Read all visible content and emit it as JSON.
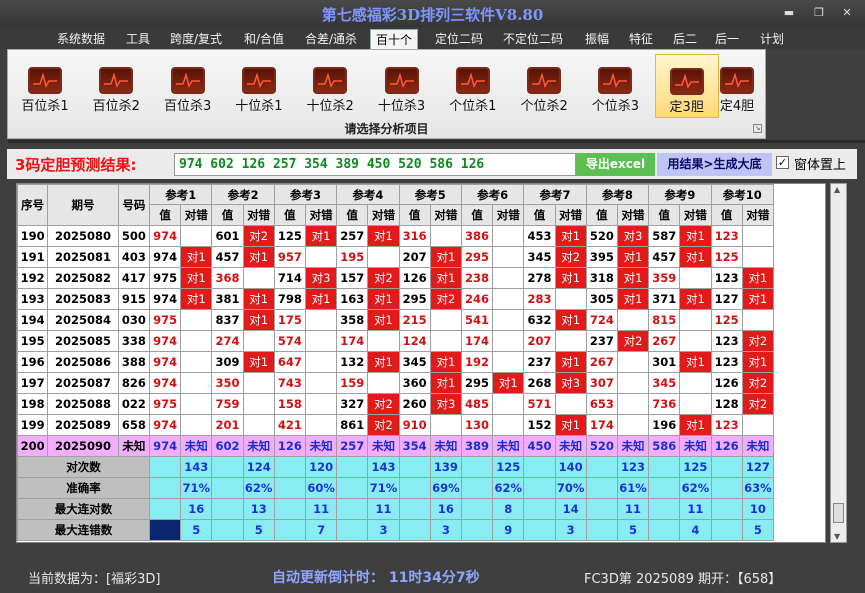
{
  "app": {
    "title": "第七感福彩3D排列三软件V8.80"
  },
  "window_controls": {
    "minimize": "▬",
    "restore": "❐",
    "close": "✕"
  },
  "menu": [
    "系统数据",
    "工具",
    "跨度/复式",
    "和/合值",
    "合差/通杀",
    "百十个",
    "定位二码",
    "不定位二码",
    "振幅",
    "特征",
    "后二",
    "后一",
    "计划"
  ],
  "menu_active": "百十个",
  "ribbon": {
    "buttons": [
      "百位杀1",
      "百位杀2",
      "百位杀3",
      "十位杀1",
      "十位杀2",
      "十位杀3",
      "个位杀1",
      "个位杀2",
      "个位杀3",
      "定3胆",
      "定4胆"
    ],
    "active": "定3胆",
    "caption": "请选择分析项目"
  },
  "prediction": {
    "label": "3码定胆预测结果:",
    "value": "974 602 126 257 354 389 450 520 586 126",
    "export_button": "导出excel",
    "big_button": "用结果>生成大底",
    "checkbox_checked": true,
    "checkbox_mark": "✓",
    "checkbox_label": "窗体置上"
  },
  "table": {
    "col_headers": {
      "seq": "序号",
      "period": "期号",
      "number": "号码"
    },
    "ref_headers": [
      "参考1",
      "参考2",
      "参考3",
      "参考4",
      "参考5",
      "参考6",
      "参考7",
      "参考8",
      "参考9",
      "参考10"
    ],
    "sub_headers": {
      "value": "值",
      "result": "对错"
    },
    "rows": [
      {
        "seq": "190",
        "period": "2025080",
        "number": "500",
        "refs": [
          [
            "974",
            ""
          ],
          [
            "601",
            "对2"
          ],
          [
            "125",
            "对1"
          ],
          [
            "257",
            "对1"
          ],
          [
            "316",
            ""
          ],
          [
            "386",
            ""
          ],
          [
            "453",
            "对1"
          ],
          [
            "520",
            "对3"
          ],
          [
            "587",
            "对1"
          ],
          [
            "123",
            ""
          ]
        ]
      },
      {
        "seq": "191",
        "period": "2025081",
        "number": "403",
        "refs": [
          [
            "974",
            "对1"
          ],
          [
            "457",
            "对1"
          ],
          [
            "957",
            ""
          ],
          [
            "195",
            ""
          ],
          [
            "207",
            "对1"
          ],
          [
            "295",
            ""
          ],
          [
            "345",
            "对2"
          ],
          [
            "395",
            "对1"
          ],
          [
            "457",
            "对1"
          ],
          [
            "125",
            ""
          ]
        ]
      },
      {
        "seq": "192",
        "period": "2025082",
        "number": "417",
        "refs": [
          [
            "975",
            "对1"
          ],
          [
            "368",
            ""
          ],
          [
            "714",
            "对3"
          ],
          [
            "157",
            "对2"
          ],
          [
            "126",
            "对1"
          ],
          [
            "238",
            ""
          ],
          [
            "278",
            "对1"
          ],
          [
            "318",
            "对1"
          ],
          [
            "359",
            ""
          ],
          [
            "123",
            "对1"
          ]
        ]
      },
      {
        "seq": "193",
        "period": "2025083",
        "number": "915",
        "refs": [
          [
            "974",
            "对1"
          ],
          [
            "381",
            "对1"
          ],
          [
            "798",
            "对1"
          ],
          [
            "163",
            "对1"
          ],
          [
            "295",
            "对2"
          ],
          [
            "246",
            ""
          ],
          [
            "283",
            ""
          ],
          [
            "305",
            "对1"
          ],
          [
            "371",
            "对1"
          ],
          [
            "127",
            "对1"
          ]
        ]
      },
      {
        "seq": "194",
        "period": "2025084",
        "number": "030",
        "refs": [
          [
            "975",
            ""
          ],
          [
            "837",
            "对1"
          ],
          [
            "175",
            ""
          ],
          [
            "358",
            "对1"
          ],
          [
            "215",
            ""
          ],
          [
            "541",
            ""
          ],
          [
            "632",
            "对1"
          ],
          [
            "724",
            ""
          ],
          [
            "815",
            ""
          ],
          [
            "125",
            ""
          ]
        ]
      },
      {
        "seq": "195",
        "period": "2025085",
        "number": "338",
        "refs": [
          [
            "974",
            ""
          ],
          [
            "274",
            ""
          ],
          [
            "574",
            ""
          ],
          [
            "174",
            ""
          ],
          [
            "124",
            ""
          ],
          [
            "174",
            ""
          ],
          [
            "207",
            ""
          ],
          [
            "237",
            "对2"
          ],
          [
            "267",
            ""
          ],
          [
            "123",
            "对2"
          ]
        ]
      },
      {
        "seq": "196",
        "period": "2025086",
        "number": "388",
        "refs": [
          [
            "974",
            ""
          ],
          [
            "309",
            "对1"
          ],
          [
            "647",
            ""
          ],
          [
            "132",
            "对1"
          ],
          [
            "345",
            "对1"
          ],
          [
            "192",
            ""
          ],
          [
            "237",
            "对1"
          ],
          [
            "267",
            ""
          ],
          [
            "301",
            "对1"
          ],
          [
            "123",
            "对1"
          ]
        ]
      },
      {
        "seq": "197",
        "period": "2025087",
        "number": "826",
        "refs": [
          [
            "974",
            ""
          ],
          [
            "350",
            ""
          ],
          [
            "743",
            ""
          ],
          [
            "159",
            ""
          ],
          [
            "360",
            "对1"
          ],
          [
            "295",
            "对1"
          ],
          [
            "268",
            "对3"
          ],
          [
            "307",
            ""
          ],
          [
            "345",
            ""
          ],
          [
            "126",
            "对2"
          ]
        ]
      },
      {
        "seq": "198",
        "period": "2025088",
        "number": "022",
        "refs": [
          [
            "975",
            ""
          ],
          [
            "759",
            ""
          ],
          [
            "158",
            ""
          ],
          [
            "327",
            "对2"
          ],
          [
            "260",
            "对3"
          ],
          [
            "485",
            ""
          ],
          [
            "571",
            ""
          ],
          [
            "653",
            ""
          ],
          [
            "736",
            ""
          ],
          [
            "128",
            "对2"
          ]
        ]
      },
      {
        "seq": "199",
        "period": "2025089",
        "number": "658",
        "refs": [
          [
            "974",
            ""
          ],
          [
            "201",
            ""
          ],
          [
            "421",
            ""
          ],
          [
            "861",
            "对2"
          ],
          [
            "910",
            ""
          ],
          [
            "130",
            ""
          ],
          [
            "152",
            "对1"
          ],
          [
            "174",
            ""
          ],
          [
            "196",
            "对1"
          ],
          [
            "123",
            ""
          ]
        ]
      }
    ],
    "prediction_row": {
      "seq": "200",
      "period": "2025090",
      "number": "未知",
      "values": [
        "974",
        "602",
        "126",
        "257",
        "354",
        "389",
        "450",
        "520",
        "586",
        "126"
      ],
      "unknown": "未知"
    },
    "stats": [
      {
        "label": "对次数",
        "values": [
          "143",
          "124",
          "120",
          "143",
          "139",
          "125",
          "140",
          "123",
          "125",
          "127"
        ]
      },
      {
        "label": "准确率",
        "values": [
          "71%",
          "62%",
          "60%",
          "71%",
          "69%",
          "62%",
          "70%",
          "61%",
          "62%",
          "63%"
        ]
      },
      {
        "label": "最大连对数",
        "values": [
          "16",
          "13",
          "11",
          "11",
          "16",
          "8",
          "14",
          "11",
          "11",
          "10"
        ]
      },
      {
        "label": "最大连错数",
        "values": [
          "5",
          "5",
          "7",
          "3",
          "3",
          "9",
          "3",
          "5",
          "4",
          "5"
        ]
      }
    ]
  },
  "status": {
    "current_data": "当前数据为：[福彩3D]",
    "countdown": "自动更新倒计时：  11时34分7秒",
    "issue": "FC3D第 2025089 期开：【658】"
  }
}
